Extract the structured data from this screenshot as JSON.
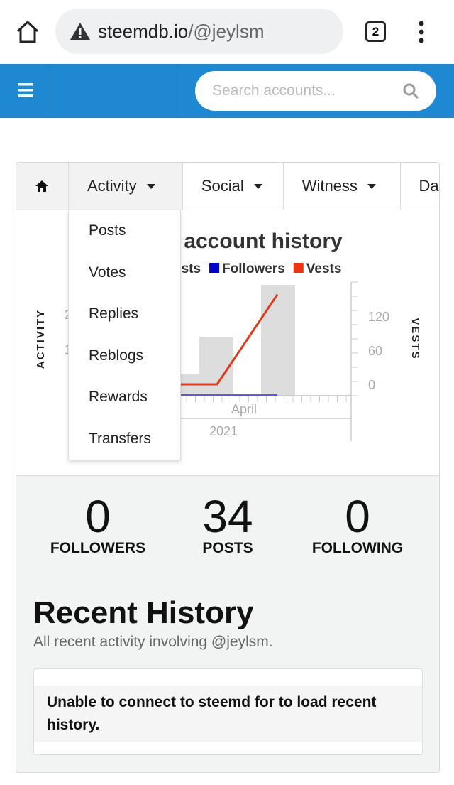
{
  "browser": {
    "url_host": "steemdb.io",
    "url_path": "/@jeylsm",
    "tab_count": "2",
    "icons": [
      "home-icon",
      "warning-icon",
      "tabs-icon",
      "more-vert-icon"
    ]
  },
  "header": {
    "search_placeholder": "Search accounts..."
  },
  "tabs": [
    {
      "label": "Activity"
    },
    {
      "label": "Social"
    },
    {
      "label": "Witness"
    },
    {
      "label": "Data"
    }
  ],
  "dropdown": [
    "Posts",
    "Votes",
    "Replies",
    "Reblogs",
    "Rewards",
    "Transfers"
  ],
  "chart_data": {
    "type": "bar+line",
    "title": "account history",
    "legend": [
      {
        "name": "osts",
        "color": "#cccccc"
      },
      {
        "name": "Followers",
        "color": "#0000cc"
      },
      {
        "name": "Vests",
        "color": "#ee3311"
      }
    ],
    "ylabel_left": "ACTIVITY",
    "ylabel_right": "VESTS",
    "left_ticks": [
      "2",
      "1"
    ],
    "right_ticks": [
      "0",
      "60",
      "120"
    ],
    "x_label": "April",
    "x_year": "2021",
    "bars": [
      30,
      82,
      155
    ],
    "vests": [
      0,
      0,
      158
    ],
    "followers": [
      0,
      0,
      0
    ]
  },
  "stats": [
    {
      "value": "0",
      "label": "FOLLOWERS"
    },
    {
      "value": "34",
      "label": "POSTS"
    },
    {
      "value": "0",
      "label": "FOLLOWING"
    }
  ],
  "recent": {
    "title": "Recent History",
    "subtitle": "All recent activity involving @jeylsm.",
    "error": "Unable to connect to steemd for to load recent history."
  }
}
